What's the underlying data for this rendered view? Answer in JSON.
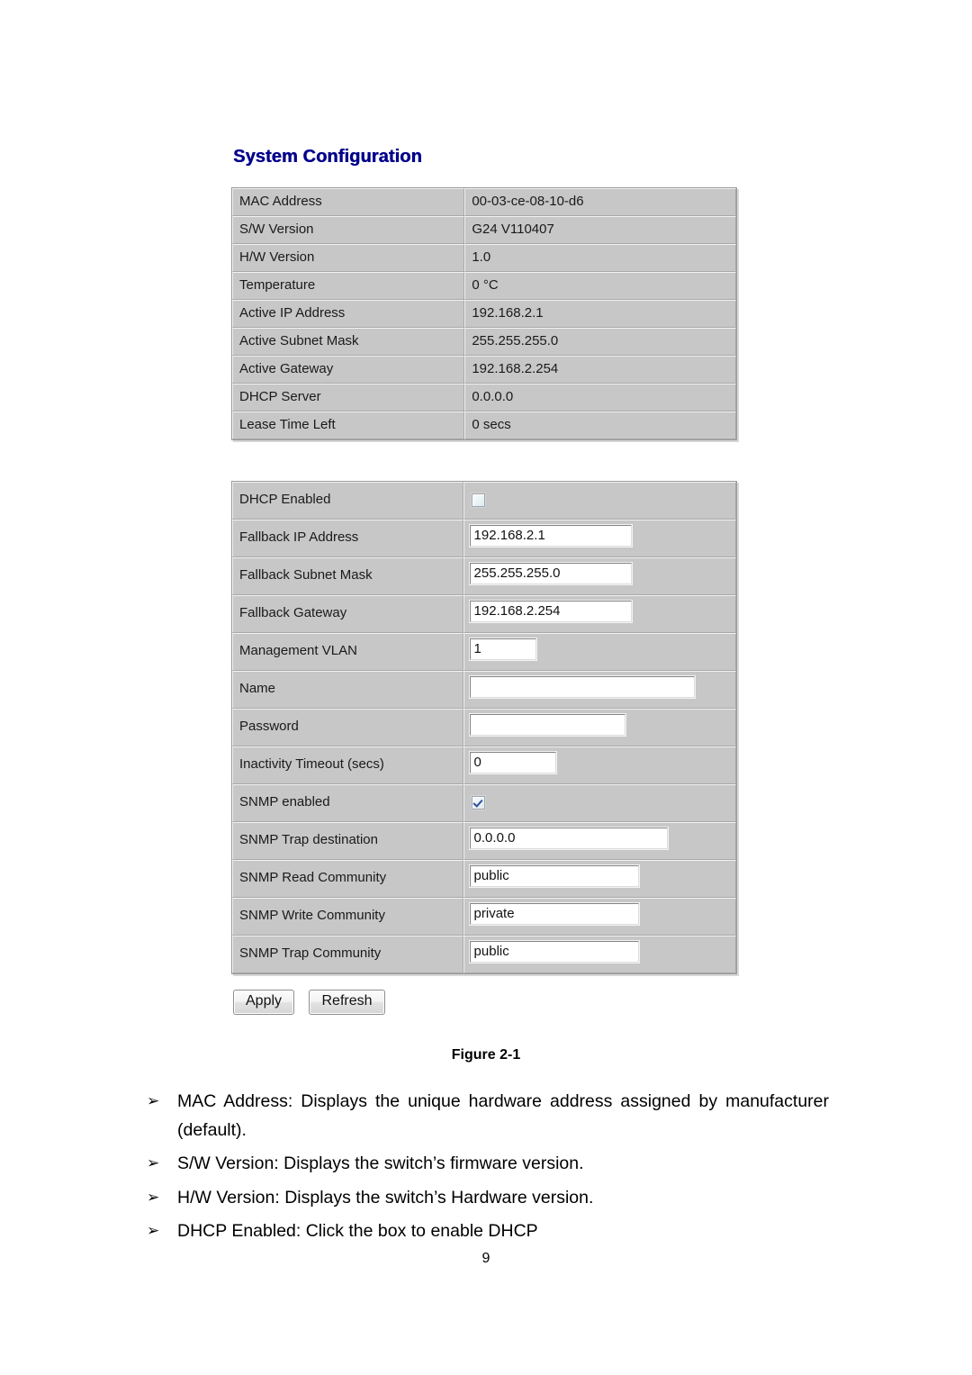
{
  "document": {
    "figure_caption": "Figure 2-1",
    "page_number": "9"
  },
  "screenshot": {
    "title": "System Configuration",
    "info_table": {
      "rows": [
        {
          "label": "MAC Address",
          "value": "00-03-ce-08-10-d6"
        },
        {
          "label": "S/W Version",
          "value": "G24 V110407"
        },
        {
          "label": "H/W Version",
          "value": "1.0"
        },
        {
          "label": "Temperature",
          "value": "0 °C"
        },
        {
          "label": "Active IP Address",
          "value": "192.168.2.1"
        },
        {
          "label": "Active Subnet Mask",
          "value": "255.255.255.0"
        },
        {
          "label": "Active Gateway",
          "value": "192.168.2.254"
        },
        {
          "label": "DHCP Server",
          "value": "0.0.0.0"
        },
        {
          "label": "Lease Time Left",
          "value": "0 secs"
        }
      ]
    },
    "form_table": {
      "rows": [
        {
          "label": "DHCP Enabled",
          "type": "checkbox",
          "checked": false,
          "value": ""
        },
        {
          "label": "Fallback IP Address",
          "type": "text",
          "value": "192.168.2.1"
        },
        {
          "label": "Fallback Subnet Mask",
          "type": "text",
          "value": "255.255.255.0"
        },
        {
          "label": "Fallback Gateway",
          "type": "text",
          "value": "192.168.2.254"
        },
        {
          "label": "Management VLAN",
          "type": "text",
          "value": "1"
        },
        {
          "label": "Name",
          "type": "text",
          "value": ""
        },
        {
          "label": "Password",
          "type": "password",
          "value": ""
        },
        {
          "label": "Inactivity Timeout (secs)",
          "type": "text",
          "value": "0"
        },
        {
          "label": "SNMP enabled",
          "type": "checkbox",
          "checked": true,
          "value": ""
        },
        {
          "label": "SNMP Trap destination",
          "type": "text",
          "value": "0.0.0.0"
        },
        {
          "label": "SNMP Read Community",
          "type": "text",
          "value": "public"
        },
        {
          "label": "SNMP Write Community",
          "type": "text",
          "value": "private"
        },
        {
          "label": "SNMP Trap Community",
          "type": "text",
          "value": "public"
        }
      ]
    },
    "buttons": {
      "apply": "Apply",
      "refresh": "Refresh"
    },
    "colors": {
      "title": "#00008b",
      "table_bg": "#c7c7c7",
      "checkmark": "#2f4f9e"
    }
  },
  "body_text": {
    "bullet_glyph": "➢",
    "items": [
      "MAC Address: Displays the unique hardware address assigned by manufacturer (default).",
      "S/W Version: Displays the switch’s firmware version.",
      "H/W Version: Displays the switch’s Hardware version.",
      "DHCP Enabled: Click the box to enable DHCP"
    ]
  }
}
